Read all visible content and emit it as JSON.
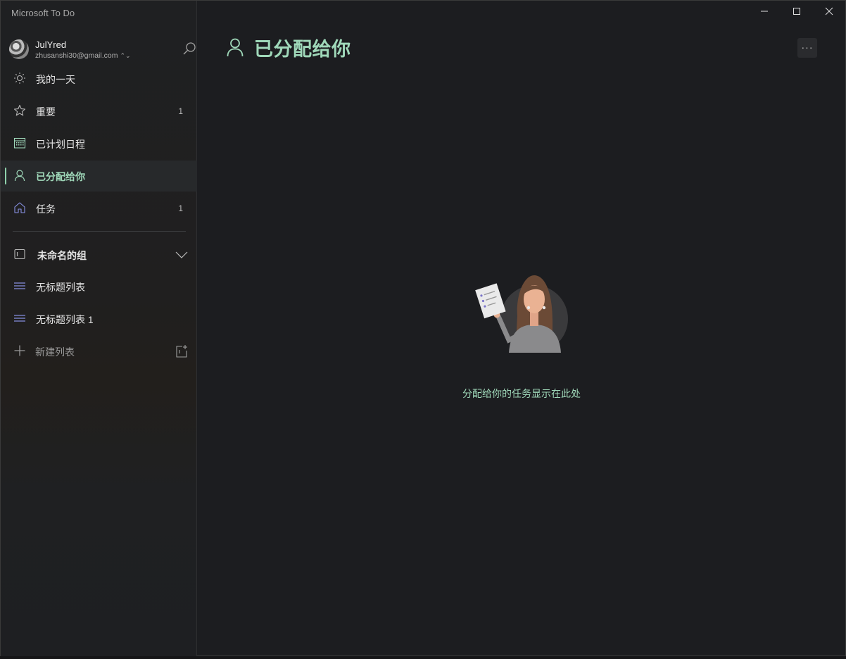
{
  "app": {
    "title": "Microsoft To Do"
  },
  "account": {
    "name": "JulYred",
    "email": "zhusanshi30@gmail.com"
  },
  "sidebar": {
    "items": [
      {
        "label": "我的一天",
        "count": "",
        "icon": "sun-icon"
      },
      {
        "label": "重要",
        "count": "1",
        "icon": "star-icon"
      },
      {
        "label": "已计划日程",
        "count": "",
        "icon": "calendar-icon"
      },
      {
        "label": "已分配给你",
        "count": "",
        "icon": "person-icon",
        "active": true
      },
      {
        "label": "任务",
        "count": "1",
        "icon": "home-icon"
      }
    ],
    "group": {
      "label": "未命名的组"
    },
    "lists": [
      {
        "label": "无标题列表"
      },
      {
        "label": "无标题列表 1"
      }
    ],
    "new_list": {
      "label": "新建列表"
    }
  },
  "main": {
    "title": "已分配给你",
    "more_label": "···",
    "empty_message": "分配给你的任务显示在此处"
  },
  "colors": {
    "accent": "#9fd8b9",
    "background": "#1c1d20",
    "sidebar": "#1f2022",
    "list_icon": "#8a93e6"
  }
}
